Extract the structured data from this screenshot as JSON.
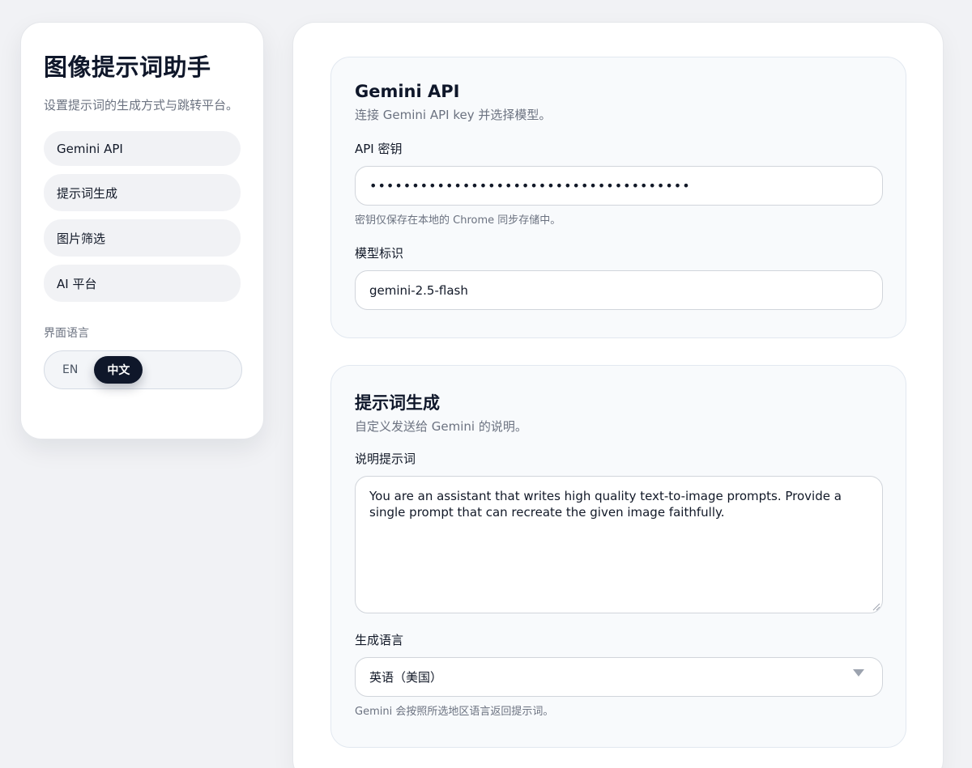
{
  "sidebar": {
    "title": "图像提示词助手",
    "subtitle": "设置提示词的生成方式与跳转平台。",
    "nav": [
      {
        "label": "Gemini API"
      },
      {
        "label": "提示词生成"
      },
      {
        "label": "图片筛选"
      },
      {
        "label": "AI 平台"
      }
    ],
    "language": {
      "label": "界面语言",
      "options": [
        "EN",
        "中文"
      ],
      "selected": "中文"
    }
  },
  "gemini_card": {
    "title": "Gemini API",
    "description": "连接 Gemini API key 并选择模型。",
    "api_key": {
      "label": "API 密钥",
      "masked_value": "••••••••••••••••••••••••••••••••••••••",
      "hint": "密钥仅保存在本地的 Chrome 同步存储中。"
    },
    "model": {
      "label": "模型标识",
      "value": "gemini-2.5-flash"
    }
  },
  "prompt_card": {
    "title": "提示词生成",
    "description": "自定义发送给 Gemini 的说明。",
    "instruction": {
      "label": "说明提示词",
      "value": "You are an assistant that writes high quality text-to-image prompts. Provide a single prompt that can recreate the given image faithfully."
    },
    "language": {
      "label": "生成语言",
      "selected": "英语（美国）",
      "hint": "Gemini 会按照所选地区语言返回提示词。"
    }
  },
  "colors": {
    "accent": "#0f172a",
    "background": "#f1f2f5",
    "muted_text": "#6b7280"
  }
}
